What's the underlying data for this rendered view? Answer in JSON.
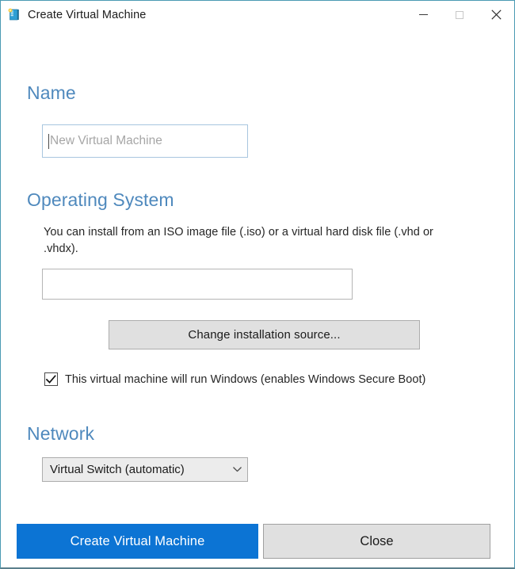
{
  "window": {
    "title": "Create Virtual Machine",
    "icon": "virtual-machine-icon",
    "border_color": "#4a9ab3",
    "controls": {
      "minimize": "minimize-icon",
      "maximize": "maximize-icon",
      "close": "close-icon"
    }
  },
  "theme": {
    "heading_blue": "#4f89bd",
    "primary_button_blue": "#0c74d4",
    "body_text": "#262626",
    "input_focus_border": "#a8c6df"
  },
  "sections": {
    "name": {
      "heading": "Name",
      "input": {
        "value": "",
        "placeholder": "New Virtual Machine"
      }
    },
    "operating_system": {
      "heading": "Operating System",
      "description": "You can install from an ISO image file (.iso) or a virtual hard disk file (.vhd or .vhdx).",
      "source_input": {
        "value": "",
        "placeholder": ""
      },
      "change_source_button": "Change installation source...",
      "secure_boot": {
        "label": "This virtual machine will run Windows (enables Windows Secure Boot)",
        "checked": true,
        "check_glyph": "checkmark-icon"
      }
    },
    "network": {
      "heading": "Network",
      "select": {
        "value": "Virtual Switch (automatic)",
        "chevron": "chevron-down-icon"
      }
    }
  },
  "footer": {
    "create_button": "Create Virtual Machine",
    "close_button": "Close"
  }
}
